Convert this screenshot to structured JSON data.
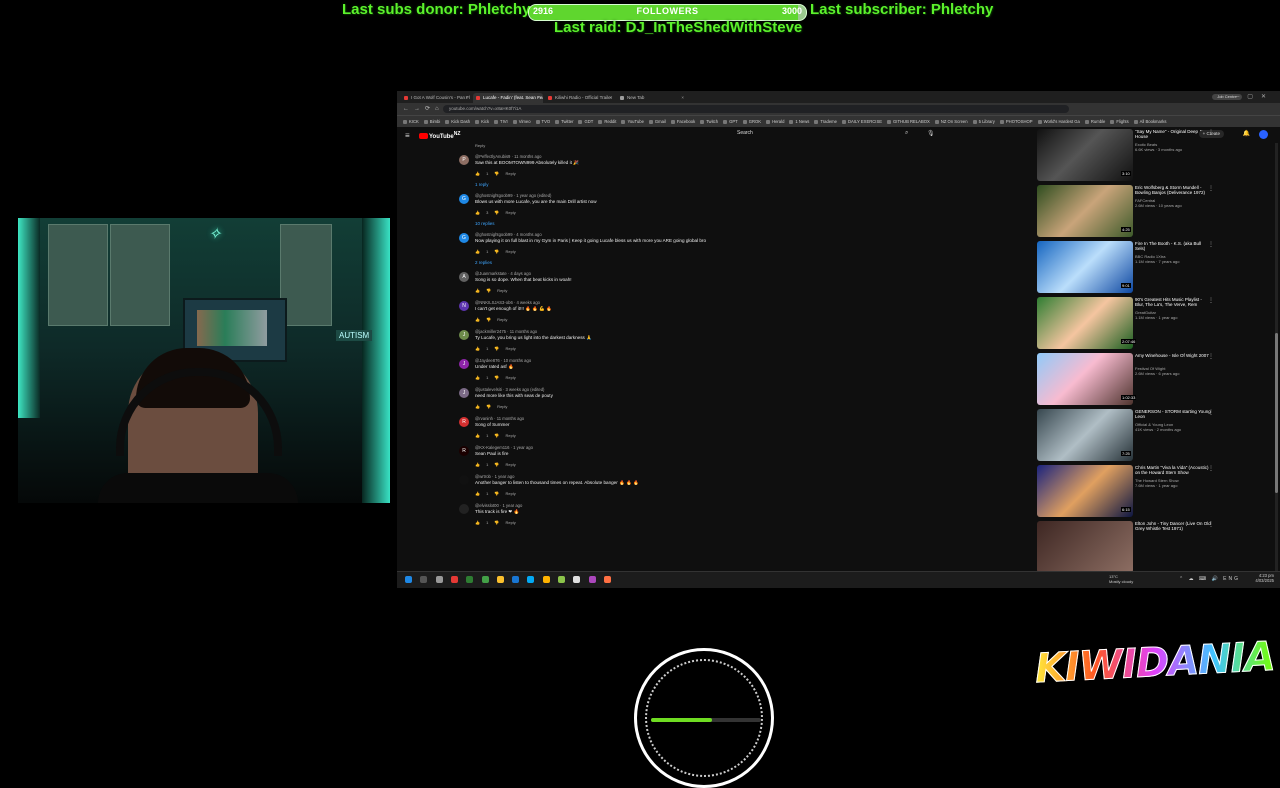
{
  "overlay": {
    "subs_donor": "Last subs donor: Phletchy",
    "last_subscriber": "Last subscriber: Phletchy",
    "last_raid": "Last raid: DJ_InTheShedWithSteve",
    "followers": {
      "label": "FOLLOWERS",
      "current": "2916",
      "goal": "3000",
      "progress": 0.972
    },
    "speed_gauge_level": 0.55,
    "webcam_sign": "AUTISM",
    "logo_text": "KIWIDANIA"
  },
  "browser": {
    "tabs": [
      {
        "title": "I Got A Wolf Cousin's - Pan Fl",
        "active": false,
        "favicon": "#e53935"
      },
      {
        "title": "Lucafe - Fadin' (feat. Sean Feat.",
        "active": true,
        "favicon": "#e53935"
      },
      {
        "title": "Kiliwhi Radio - Official Trailer",
        "active": false,
        "favicon": "#e53935"
      },
      {
        "title": "New Tab",
        "active": false,
        "favicon": "#9e9e9e"
      }
    ],
    "profile": "Job Centre",
    "url": "youtube.com/watch?v=x8aHK0f7i1A",
    "bookmarks": [
      "KICK",
      "Bimbi",
      "Kick Dash",
      "Kick",
      "TIVI",
      "Vimeo",
      "TVO",
      "Twitter",
      "GDT",
      "Reddit",
      "YouTube",
      "Gmail",
      "Facebook",
      "Twitch",
      "GPT",
      "GROK",
      "Herald",
      "1 News",
      "Trademe",
      "DAILY EXERCISE",
      "GITHUB RELABOX",
      "NZ On Screen",
      "5 Library",
      "PHOTOSHOP",
      "World's Hardest Ga",
      "Rumble",
      "Flights",
      "All Bookmarks"
    ]
  },
  "youtube": {
    "logo": "YouTube",
    "logo_sup": "NZ",
    "search_placeholder": "Search",
    "create_label": "+ Create",
    "top_actions": "Reply",
    "comments": [
      {
        "av": "P",
        "avcolor": "#8d6e63",
        "author": "@PeffectlyAnubis9 · 11 months ago",
        "text": "Saw this at BOOMTOWN999 Absolutely killed it 🎉",
        "actions": "👍 1 👎 Reply",
        "replies": "1 reply"
      },
      {
        "av": "G",
        "avcolor": "#1e88e5",
        "author": "@ghostnightgoob99 · 1 year ago (edited)",
        "text": "Blows us with more Lucafe, you are the main Drill artist now",
        "actions": "👍 3 👎 Reply",
        "replies": "10 replies"
      },
      {
        "av": "G",
        "avcolor": "#1e88e5",
        "author": "@ghostnightgoob99 · 4 months ago",
        "text": "Now playing it on full blast in my Gym in Paris | Keep it going Lucafe bless us with more you ARE going global bro",
        "actions": "👍 1 👎 Reply",
        "replies": "2 replies"
      },
      {
        "av": "A",
        "avcolor": "#616161",
        "author": "@Juanmarkstate · 4 days ago",
        "text": "Song is so dope. When that beat kicks in woah!",
        "actions": "👍 👎 Reply",
        "replies": ""
      },
      {
        "av": "N",
        "avcolor": "#5e35b1",
        "author": "@NNKILSJAS3-ob6 · 4 weeks ago",
        "text": "I can't get enough of it!!! 🔥 🔥 💪 🔥",
        "actions": "👍 👎 Reply",
        "replies": ""
      },
      {
        "av": "J",
        "avcolor": "#6d8b4a",
        "author": "@jackmiller2475 · 11 months ago",
        "text": "Ty Lucafe, you bring us light into the darkest darkness 🙏",
        "actions": "👍 1 👎 Reply",
        "replies": ""
      },
      {
        "av": "J",
        "avcolor": "#8e24aa",
        "author": "@Jaydee876 · 10 months ago",
        "text": "Under rated asf 🔥",
        "actions": "👍 1 👎 Reply",
        "replies": ""
      },
      {
        "av": "J",
        "avcolor": "#7b6a86",
        "author": "@justalevelsiti · 3 weeks ago (edited)",
        "text": "need more like this with seas de pouty",
        "actions": "👍 👎 Reply",
        "replies": ""
      },
      {
        "av": "R",
        "avcolor": "#d32f2f",
        "author": "@rvaninh · 11 months ago",
        "text": "Song of Summer",
        "actions": "👍 1 👎 Reply",
        "replies": ""
      },
      {
        "av": "R",
        "avcolor": "#1a0000",
        "author": "@KX-Kalegem116 · 1 year ago",
        "text": "Sean Paul is fire",
        "actions": "👍 1 👎 Reply",
        "replies": ""
      },
      {
        "av": "",
        "avcolor": "#111111",
        "author": "@wrtrob · 1 year ago",
        "text": "Another banger to listen to thousand times on repeat. Absolute banger 🔥 🔥 🔥",
        "actions": "👍 1 👎 Reply",
        "replies": ""
      },
      {
        "av": "",
        "avcolor": "#222222",
        "author": "@elvisslot00 · 1 year ago",
        "text": "This track is fire ❤ 🔥",
        "actions": "👍 1 👎 Reply",
        "replies": ""
      }
    ],
    "related": [
      {
        "title": "\"Say My Name\" - Original Deep House",
        "channel": "Exotic Beats",
        "meta": "6.6K views · 3 months ago",
        "dur": "3:10",
        "thumb": "linear-gradient(135deg,#111 0%,#555 45%,#111 100%)"
      },
      {
        "title": "Eric Wolfsberg & Storm Mundell - Bowling Banjos (Deliverance 1972)",
        "channel": "FAFCentral",
        "meta": "2.6M views · 10 years ago",
        "dur": "4:25",
        "thumb": "linear-gradient(135deg,#2e4d1f 0%,#c9a47a 50%,#3d5a2a 100%)"
      },
      {
        "title": "Fire In The Booth - K.S. (aka Bull Sels)",
        "channel": "BBC Radio 1Xtra",
        "meta": "1.1M views · 7 years ago",
        "dur": "9:01",
        "thumb": "linear-gradient(135deg,#1565c0 0%,#bbdefb 50%,#0d47a1 100%)"
      },
      {
        "title": "90's Greatest Hits Music Playlist - Blur, The La's, The Verve, Rem",
        "channel": "GreatGuitar",
        "meta": "1.1M views · 1 year ago",
        "dur": "2:07:46",
        "thumb": "linear-gradient(135deg,#2e7d32 0%,#f5c5a0 50%,#1b5e20 100%)"
      },
      {
        "title": "Amy Winehouse - Isle Of Wight 2007",
        "channel": "Festival Of Wight",
        "meta": "2.6M views · 6 years ago",
        "dur": "1:02:33",
        "thumb": "linear-gradient(135deg,#90caf9 0%,#f8bbd0 45%,#4e342e 100%)"
      },
      {
        "title": "GENERSON - STORM starting Young Leon",
        "channel": "Official & Young Leon",
        "meta": "41K views · 2 months ago",
        "dur": "7:25",
        "thumb": "linear-gradient(135deg,#37474f 0%,#b0bec5 50%,#263238 100%)"
      },
      {
        "title": "Chris Martin \"Viva la Vida\" (Acoustic) on the Howard Stern Show",
        "channel": "The Howard Stern Show",
        "meta": "7.6M views · 1 year ago",
        "dur": "6:15",
        "thumb": "linear-gradient(135deg,#1a237e 0%,#e0a060 50%,#0d1642 100%)"
      },
      {
        "title": "Elton John - Tiny Dancer (Live On Old Grey Whistle Test 1971)",
        "channel": "",
        "meta": "",
        "dur": "",
        "thumb": "linear-gradient(135deg,#3e2723 0%,#8d6e63 100%)"
      }
    ]
  },
  "taskbar": {
    "weather_temp": "13°C",
    "weather_desc": "Mostly cloudy",
    "lang": "ENG",
    "time": "4:23 pm",
    "date": "4/03/2025"
  },
  "colors": {
    "overlay_green": "#5cf22c",
    "yt_red": "#ff0000",
    "link_blue": "#3ea6ff"
  }
}
